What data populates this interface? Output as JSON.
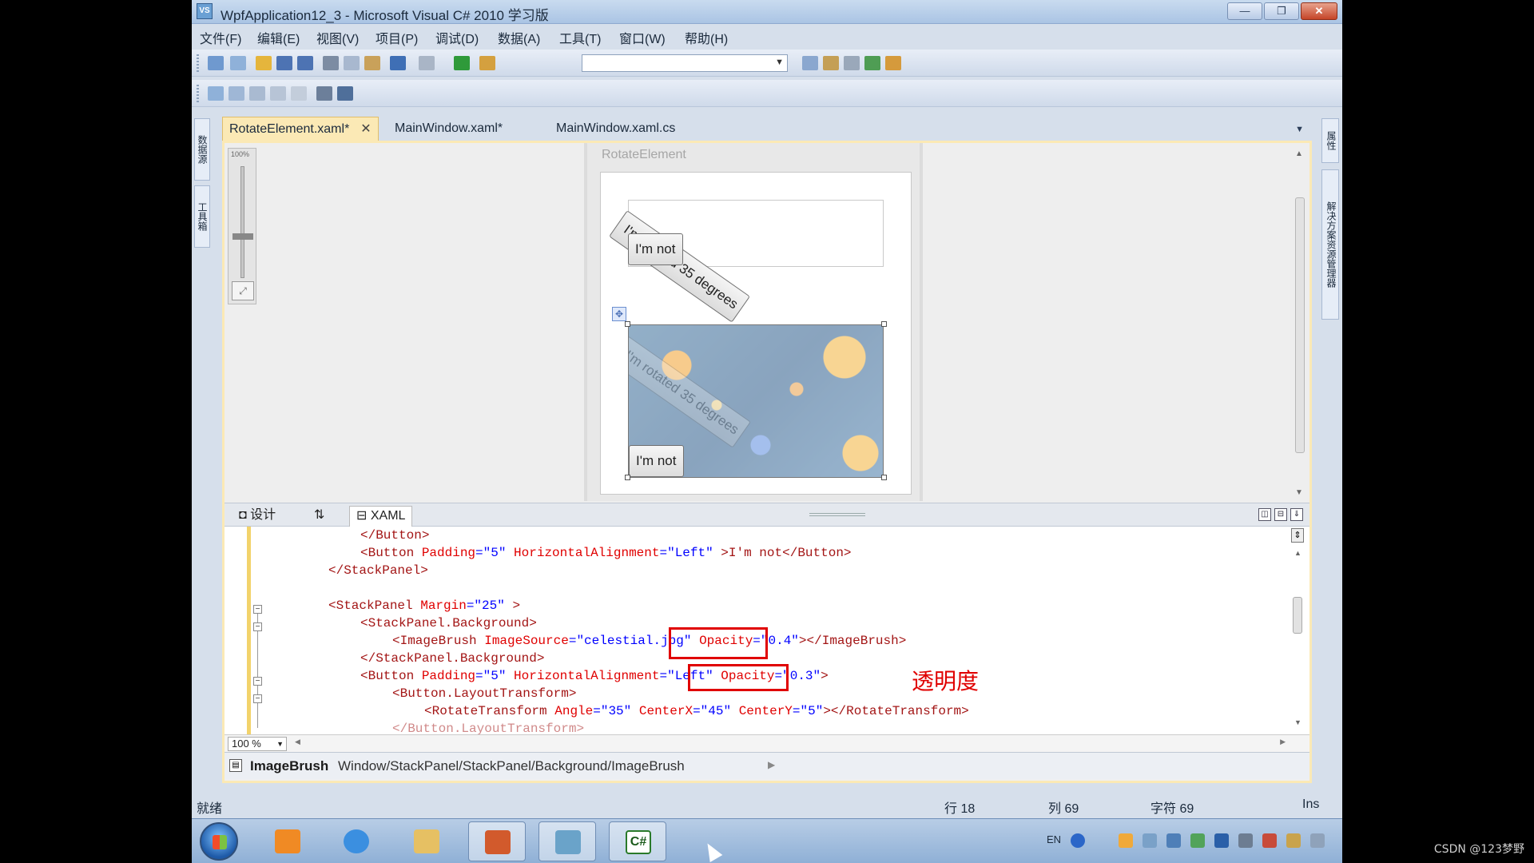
{
  "window": {
    "title": "WpfApplication12_3 - Microsoft Visual C# 2010 学习版",
    "app_icon": "vs-icon",
    "controls": {
      "minimize": "—",
      "maximize": "❐",
      "close": "✕"
    }
  },
  "menu": [
    "文件(F)",
    "编辑(E)",
    "视图(V)",
    "项目(P)",
    "调试(D)",
    "数据(A)",
    "工具(T)",
    "窗口(W)",
    "帮助(H)"
  ],
  "left_panels": [
    "数据源",
    "工具箱"
  ],
  "right_panels": [
    "属性",
    "解决方案资源管理器"
  ],
  "doc_tabs": [
    {
      "label": "RotateElement.xaml*",
      "active": true,
      "closable": true
    },
    {
      "label": "MainWindow.xaml*",
      "active": false
    },
    {
      "label": "MainWindow.xaml.cs",
      "active": false
    }
  ],
  "designer": {
    "zoom_label": "100%",
    "window_title": "RotateElement",
    "rotated_button": "I'm rotated 35 degrees",
    "plain_button": "I'm not",
    "rotation_angle": 35
  },
  "split_tabs": {
    "design": "设计",
    "swap": "⇅",
    "xaml": "XAML"
  },
  "code": {
    "l1": "</Button>",
    "l2_a": "<Button ",
    "l2_b": "Padding",
    "l2_c": "=\"5\" ",
    "l2_d": "HorizontalAlignment",
    "l2_e": "=\"Left\" ",
    "l2_f": ">I'm not</Button>",
    "l3": "</StackPanel>",
    "l4_a": "<StackPanel ",
    "l4_b": "Margin",
    "l4_c": "=\"25\" ",
    "l4_d": ">",
    "l5": "<StackPanel.Background>",
    "l6_a": "<ImageBrush ",
    "l6_b": "ImageSource",
    "l6_c": "=\"celestial.jpg\" ",
    "l6_d": "Opacity",
    "l6_e": "=\"0.4\"",
    "l6_f": "></ImageBrush>",
    "l7": "</StackPanel.Background>",
    "l8_a": "<Button ",
    "l8_b": "Padding",
    "l8_c": "=\"5\" ",
    "l8_d": "HorizontalAlignment",
    "l8_e": "=\"Left\" ",
    "l8_f": "Opacity",
    "l8_g": "=\"0.3\"",
    "l8_h": ">",
    "l9": "<Button.LayoutTransform>",
    "l10_a": "<RotateTransform ",
    "l10_b": "Angle",
    "l10_c": "=\"35\" ",
    "l10_d": "CenterX",
    "l10_e": "=\"45\" ",
    "l10_f": "CenterY",
    "l10_g": "=\"5\"",
    "l10_h": "></RotateTransform>",
    "l11": "</Button.LayoutTransform>"
  },
  "annotation": "透明度",
  "zoom_combo": "100 %",
  "breadcrumb": {
    "element": "ImageBrush",
    "path": "Window/StackPanel/StackPanel/Background/ImageBrush"
  },
  "status": {
    "ready": "就绪",
    "row": "行 18",
    "col": "列 69",
    "char": "字符 69",
    "mode": "Ins"
  },
  "taskbar": {
    "apps": [
      "media-player",
      "internet-explorer",
      "file-explorer",
      "powerpoint",
      "tool",
      "visual-csharp"
    ],
    "active_app": "visual-csharp",
    "csharp_label": "C#",
    "lang": "EN"
  },
  "watermark": "CSDN @123梦野",
  "colors": {
    "accent_tab": "#fbe9b5",
    "highlight": "#e00000"
  }
}
